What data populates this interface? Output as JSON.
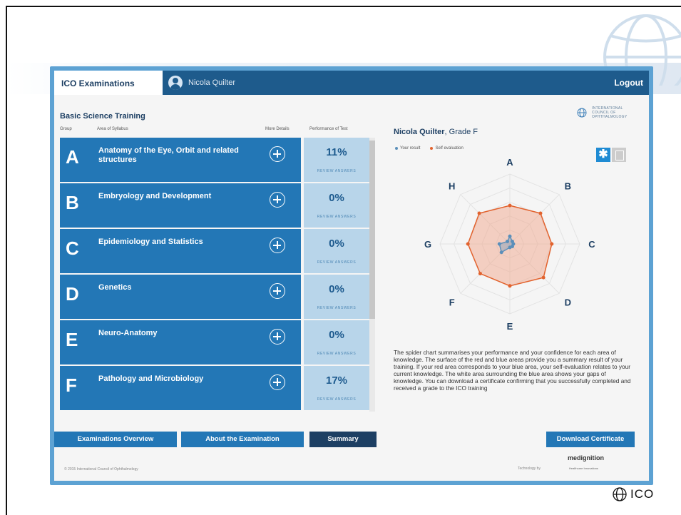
{
  "header": {
    "active_tab": "ICO Examinations",
    "user_name": "Nicola Quilter",
    "logout": "Logout"
  },
  "section_title": "Basic Science Training",
  "org_logo_text": "INTERNATIONAL COUNCIL OF OPHTHALMOLOGY",
  "table_headers": {
    "group": "Group",
    "area": "Area of Syllabus",
    "details": "More Details",
    "performance": "Performance of Test"
  },
  "review_label": "REVIEW ANSWERS",
  "rows": [
    {
      "letter": "A",
      "name": "Anatomy of the Eye, Orbit and related structures",
      "pct": "11%"
    },
    {
      "letter": "B",
      "name": "Embryology and Development",
      "pct": "0%"
    },
    {
      "letter": "C",
      "name": "Epidemiology and Statistics",
      "pct": "0%"
    },
    {
      "letter": "D",
      "name": "Genetics",
      "pct": "0%"
    },
    {
      "letter": "E",
      "name": "Neuro-Anatomy",
      "pct": "0%"
    },
    {
      "letter": "F",
      "name": "Pathology and Microbiology",
      "pct": "17%"
    }
  ],
  "chart_panel": {
    "name": "Nicola Quilter",
    "grade": ", Grade F",
    "legend_result": "Your result",
    "legend_self": "Self evaluation",
    "result_color": "#5b8fba",
    "self_color": "#e2622d",
    "description": "The spider chart summarises your performance and your confidence for each area of knowledge. The surface of the red and blue areas provide you a summary result of your training. If your red area corresponds to your blue area, your self-evaluation relates to your current knowledge. The white area surrounding the blue area shows your gaps of knowledge. You can download a certificate confirming that you successfully completed and received a grade to the ICO training"
  },
  "chart_data": {
    "type": "radar",
    "categories": [
      "A",
      "B",
      "C",
      "D",
      "E",
      "F",
      "G",
      "H"
    ],
    "range": [
      0,
      1
    ],
    "series": [
      {
        "name": "Your result",
        "values": [
          0.11,
          0.05,
          0.05,
          0.05,
          0.05,
          0.17,
          0.15,
          0.05
        ]
      },
      {
        "name": "Self evaluation",
        "values": [
          0.55,
          0.62,
          0.6,
          0.68,
          0.6,
          0.6,
          0.6,
          0.62
        ]
      }
    ]
  },
  "buttons": {
    "overview": "Examinations Overview",
    "about": "About the Examination",
    "summary": "Summary",
    "download": "Download Certificate"
  },
  "footer": {
    "copyright": "© 2015 International Council of Ophthalmology",
    "tech_by": "Technology by",
    "tech_brand": "medignition",
    "tech_sub": "Healthcare Innovations"
  },
  "ico_mark": "ICO"
}
